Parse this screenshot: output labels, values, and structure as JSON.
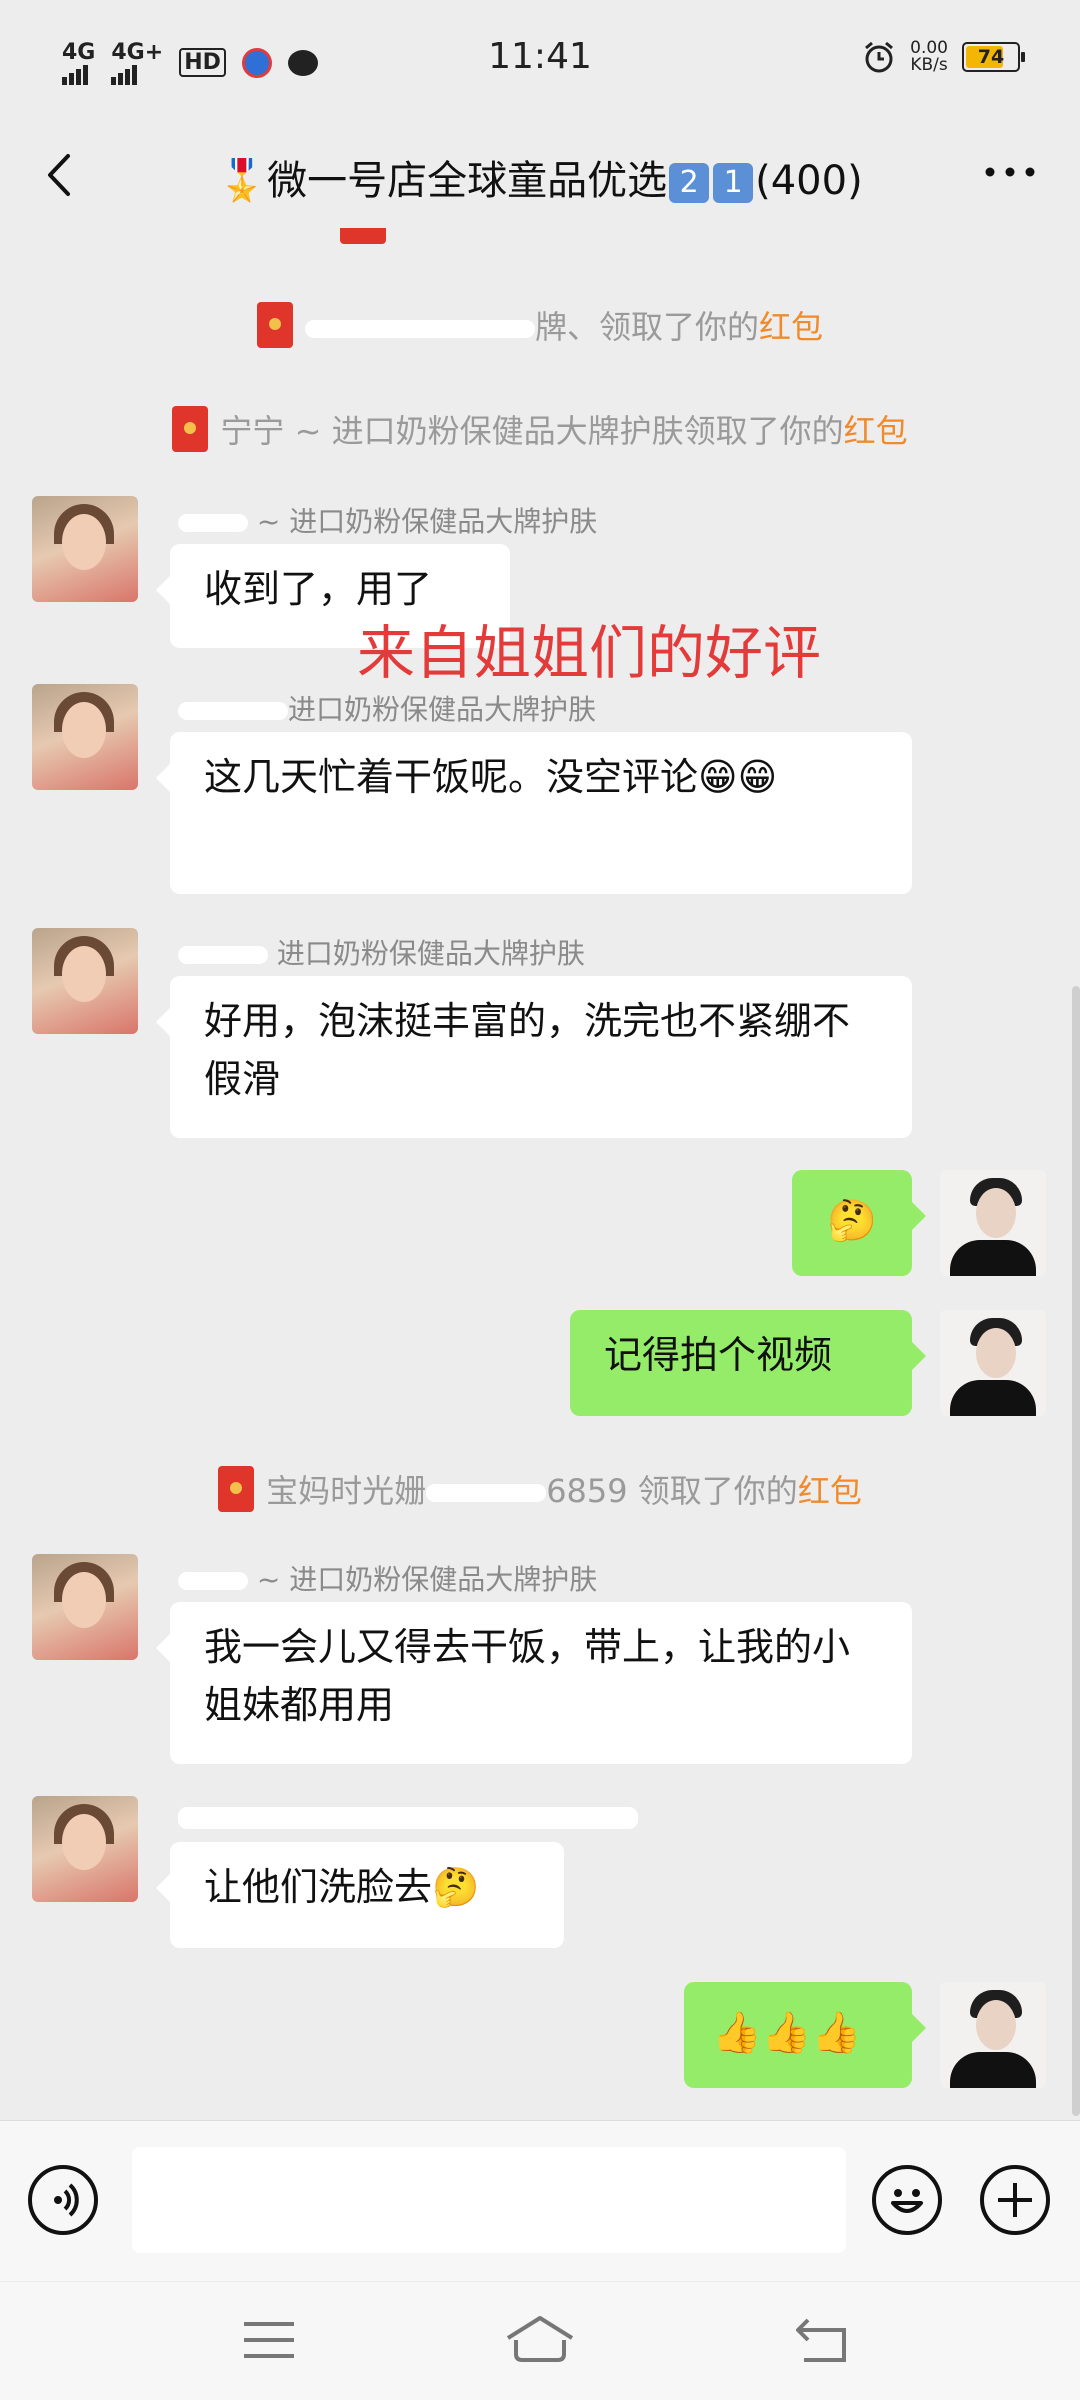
{
  "status_bar": {
    "net1": "4G",
    "net2": "4G+",
    "hd": "HD",
    "time": "11:41",
    "speed_value": "0.00",
    "speed_unit": "KB/s",
    "battery": "74",
    "battery_level": 0.74,
    "icons": [
      "alarm-icon",
      "chat-bubble-icon",
      "app-icon"
    ]
  },
  "header": {
    "title_prefix": "🎖️微一号店全球童品优选",
    "num1": "2",
    "num2": "1",
    "count": "(400)"
  },
  "system_messages": [
    {
      "prefix": "",
      "suffix": "牌、领取了你的",
      "highlight": "红包"
    },
    {
      "prefix": "宁宁 ~ 进口奶粉保健品大牌护肤领取了你的",
      "suffix": "",
      "highlight": "红包"
    },
    {
      "prefix": "宝妈时光姗",
      "suffix": "6859 领取了你的",
      "highlight": "红包"
    }
  ],
  "group_suffix": "~ 进口奶粉保健品大牌护肤",
  "group_suffix_short": "进口奶粉保健品大牌护肤",
  "overlay_text": "来自姐姐们的好评",
  "messages": [
    {
      "text": "收到了，用了"
    },
    {
      "text": "这几天忙着干饭呢。没空评论😁😁"
    },
    {
      "text": "好用，泡沫挺丰富的，洗完也不紧绷不假滑"
    },
    {
      "text": "🤔"
    },
    {
      "text": "记得拍个视频"
    },
    {
      "text": "我一会儿又得去干饭，带上，让我的小姐妹都用用"
    },
    {
      "text": "让他们洗脸去🤔"
    },
    {
      "text": "👍👍👍"
    }
  ],
  "input": {
    "value": ""
  },
  "colors": {
    "background": "#ededed",
    "my_bubble": "#95ec69",
    "red_packet": "#e0352b",
    "highlight": "#f08a2b",
    "overlay": "#e33a3a"
  }
}
